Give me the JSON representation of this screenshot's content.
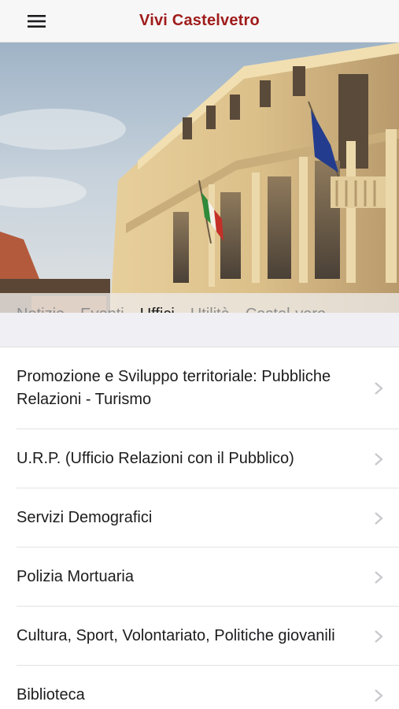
{
  "header": {
    "title": "Vivi Castelvetro",
    "menu_icon": "hamburger-menu-icon"
  },
  "hero": {
    "tabs": [
      {
        "label": "Notizie",
        "active": false
      },
      {
        "label": "Eventi",
        "active": false
      },
      {
        "label": "Uffici",
        "active": true
      },
      {
        "label": "Utilità",
        "active": false
      },
      {
        "label": "Castel-vero",
        "active": false
      }
    ]
  },
  "list": {
    "items": [
      {
        "label_line1": "Promozione e Sviluppo territoriale: Pubbliche",
        "label_line2": "Relazioni - Turismo"
      },
      {
        "label": "U.R.P. (Ufficio Relazioni con il Pubblico)"
      },
      {
        "label": "Servizi Demografici"
      },
      {
        "label": "Polizia Mortuaria"
      },
      {
        "label": "Cultura, Sport, Volontariato, Politiche giovanili"
      },
      {
        "label": "Biblioteca"
      }
    ],
    "chevron_icon": "chevron-right-icon"
  },
  "colors": {
    "brand": "#a01c1c",
    "tab_active": "#1c1c1e",
    "tab_inactive": "#8e8e8e",
    "chevron": "#c7c7cc"
  }
}
